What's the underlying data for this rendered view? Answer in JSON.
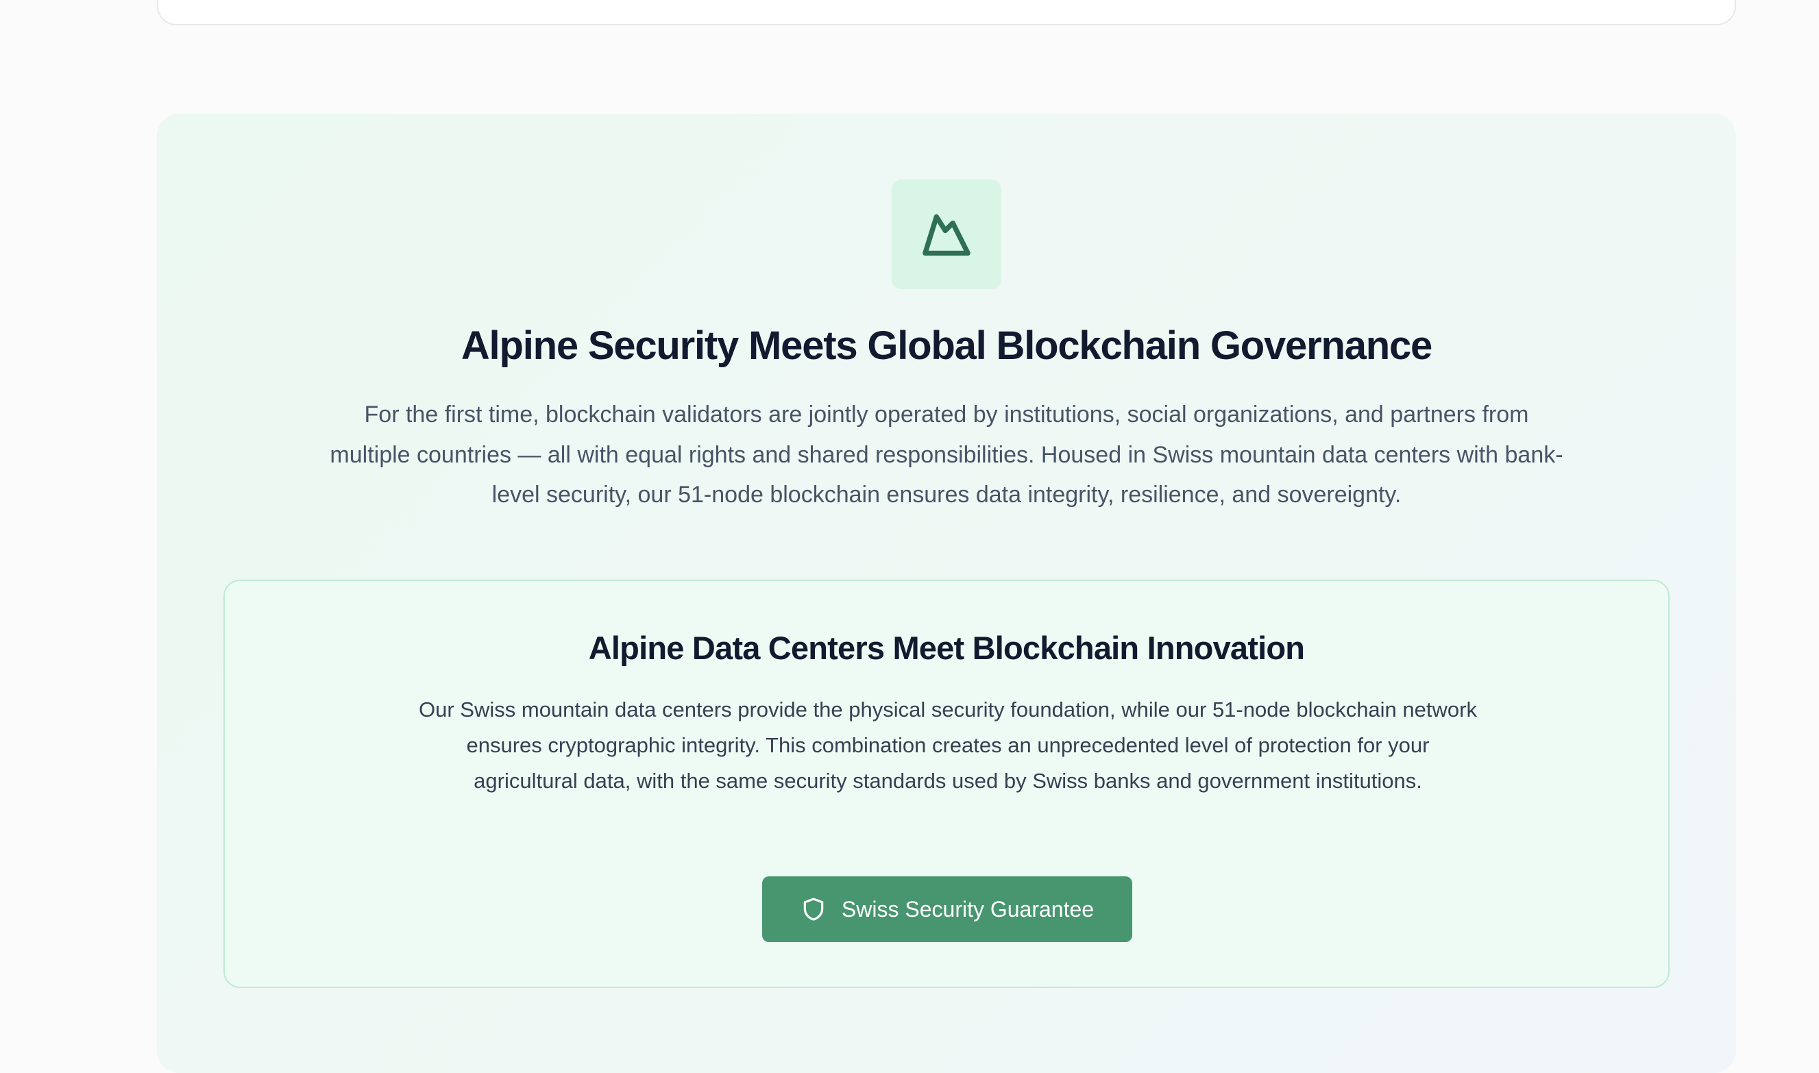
{
  "hero": {
    "icon": "mountain-icon",
    "title": "Alpine Security Meets Global Blockchain Governance",
    "description": "For the first time, blockchain validators are jointly operated by institutions, social organizations, and partners from multiple countries — all with equal rights and shared responsibilities. Housed in Swiss mountain data centers with bank-level security, our 51-node blockchain ensures data integrity, resilience, and sovereignty."
  },
  "feature_card": {
    "title": "Alpine Data Centers Meet Blockchain Innovation",
    "body": "Our Swiss mountain data centers provide the physical security foundation, while our 51-node blockchain network ensures cryptographic integrity. This combination creates an unprecedented level of protection for your agricultural data, with the same security standards used by Swiss banks and government institutions.",
    "button": {
      "icon": "shield-icon",
      "label": "Swiss Security Guarantee"
    }
  },
  "colors": {
    "accent": "#489670",
    "icon_stroke": "#2f6f53",
    "icon_tile": "#d9f5e6",
    "heading": "#111a2e",
    "body_text": "#475467"
  }
}
